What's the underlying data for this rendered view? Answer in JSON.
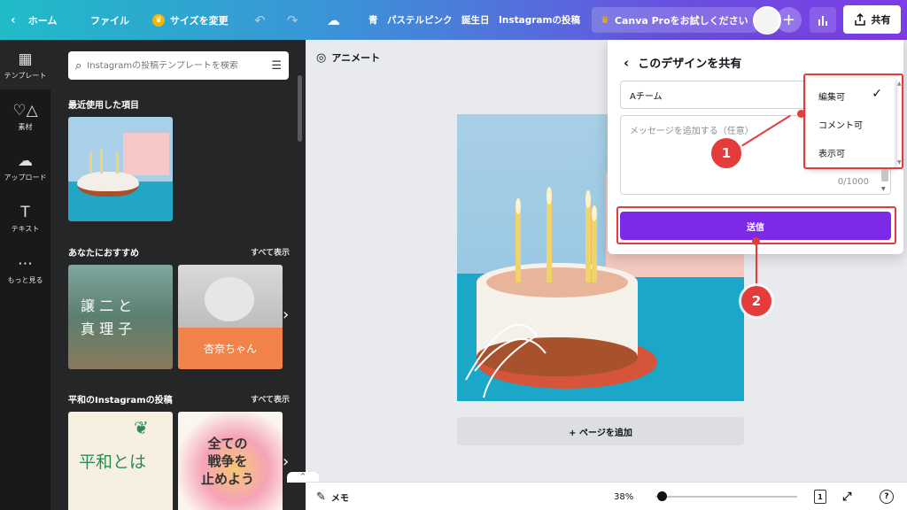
{
  "topbar": {
    "home": "ホーム",
    "file": "ファイル",
    "resize": "サイズを変更",
    "title": "青　パステルピンク　誕生日　Instagramの投稿",
    "pro": "Canva Proをお試しください",
    "share": "共有"
  },
  "rail": {
    "items": [
      {
        "label": "テンプレート",
        "icon": "template-icon"
      },
      {
        "label": "素材",
        "icon": "elements-icon"
      },
      {
        "label": "アップロード",
        "icon": "upload-icon"
      },
      {
        "label": "テキスト",
        "icon": "text-icon"
      },
      {
        "label": "もっと見る",
        "icon": "more-icon"
      }
    ]
  },
  "panel": {
    "search_placeholder": "Instagramの投稿テンプレートを検索",
    "recent_title": "最近使用した項目",
    "recommended_title": "あなたにおすすめ",
    "see_all": "すべて表示",
    "peace_title": "平和のInstagramの投稿",
    "see_all_2": "すべて表示",
    "thumb1_text": "譲 二 と\n真 理 子",
    "thumb2_text": "杏奈ちゃん",
    "thumb3_text": "平和とは",
    "thumb4_text": "全ての\n戦争を\n止めよう"
  },
  "canvas": {
    "animate": "アニメート",
    "add_page": "+ ページを追加"
  },
  "bottombar": {
    "notes": "メモ",
    "zoom": "38%",
    "page_num": "1",
    "zoom_fraction": 0.05
  },
  "share_popup": {
    "title": "このデザインを共有",
    "team": "Aチーム",
    "message_placeholder": "メッセージを追加する（任意）",
    "counter": "0/1000",
    "send": "送信",
    "permissions": [
      "編集可",
      "コメント可",
      "表示可"
    ],
    "selected_permission": "編集可"
  },
  "annotations": {
    "marker1": "1",
    "marker2": "2"
  },
  "colors": {
    "accent": "#7d2ae8",
    "annotation": "#e43b3b"
  }
}
